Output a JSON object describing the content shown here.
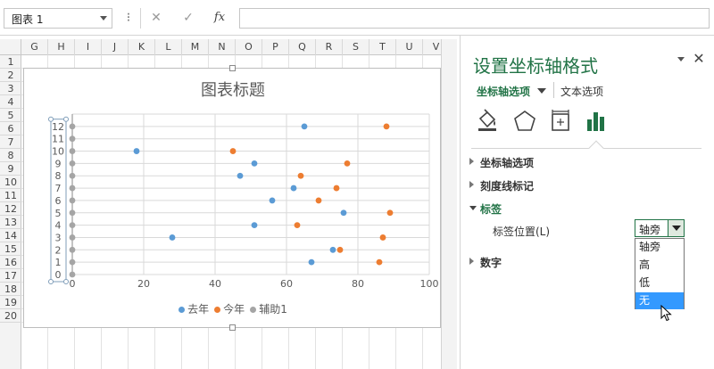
{
  "formula_bar": {
    "name_box": "图表 1",
    "more_icon": "⁝",
    "cancel_icon": "✕",
    "enter_icon": "✓",
    "fx_label": "fx",
    "formula_value": ""
  },
  "sheet": {
    "columns": [
      "G",
      "H",
      "I",
      "J",
      "K",
      "L",
      "M",
      "N",
      "O",
      "P",
      "Q",
      "R",
      "S",
      "T",
      "U",
      "V"
    ],
    "rows": [
      "1",
      "2",
      "3",
      "4",
      "5",
      "6",
      "7",
      "8",
      "9",
      "10",
      "11",
      "12",
      "13",
      "14",
      "15",
      "16",
      "17",
      "18",
      "19",
      "20"
    ]
  },
  "chart_data": {
    "type": "scatter",
    "title": "图表标题",
    "xlim": [
      0,
      100
    ],
    "ylim": [
      0,
      13
    ],
    "x_ticks": [
      "0",
      "20",
      "40",
      "60",
      "80",
      "100"
    ],
    "y_ticks": [
      "0",
      "1",
      "2",
      "3",
      "4",
      "5",
      "6",
      "7",
      "8",
      "9",
      "10",
      "11",
      "12"
    ],
    "grid": true,
    "legend_position": "bottom",
    "series": [
      {
        "name": "去年",
        "color": "#5b9bd5",
        "points": [
          [
            65,
            12
          ],
          [
            18,
            10
          ],
          [
            51,
            9
          ],
          [
            47,
            8
          ],
          [
            62,
            7
          ],
          [
            56,
            6
          ],
          [
            76,
            5
          ],
          [
            51,
            4
          ],
          [
            28,
            3
          ],
          [
            73,
            2
          ],
          [
            67,
            1
          ]
        ]
      },
      {
        "name": "今年",
        "color": "#ed7d31",
        "points": [
          [
            88,
            12
          ],
          [
            45,
            10
          ],
          [
            77,
            9
          ],
          [
            64,
            8
          ],
          [
            74,
            7
          ],
          [
            69,
            6
          ],
          [
            89,
            5
          ],
          [
            63,
            4
          ],
          [
            87,
            3
          ],
          [
            75,
            2
          ],
          [
            86,
            1
          ]
        ]
      },
      {
        "name": "辅助1",
        "color": "#a5a5a5",
        "points": [
          [
            0,
            12
          ],
          [
            0,
            11
          ],
          [
            0,
            10
          ],
          [
            0,
            9
          ],
          [
            0,
            8
          ],
          [
            0,
            7
          ],
          [
            0,
            6
          ],
          [
            0,
            5
          ],
          [
            0,
            4
          ],
          [
            0,
            3
          ],
          [
            0,
            2
          ],
          [
            0,
            1
          ],
          [
            0,
            0
          ]
        ]
      }
    ]
  },
  "panel": {
    "title": "设置坐标轴格式",
    "close_icon": "✕",
    "tab_axis_options": "坐标轴选项",
    "tab_text_options": "文本选项",
    "sections": {
      "axis_options": "坐标轴选项",
      "tick_marks": "刻度线标记",
      "labels": "标签",
      "number": "数字"
    },
    "label_position_label": "标签位置(L)",
    "label_position_value": "轴旁",
    "options": [
      "轴旁",
      "高",
      "低",
      "无"
    ],
    "highlighted_option": "无"
  }
}
